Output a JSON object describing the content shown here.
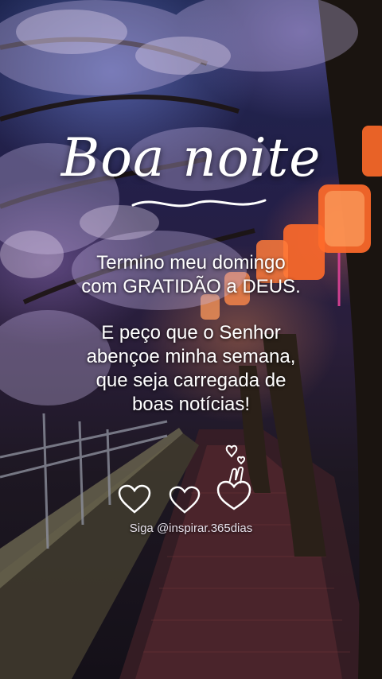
{
  "image": {
    "description_colors": {
      "sky": "#1d2550",
      "lantern": "#ff6a2a",
      "text": "#ffffff"
    }
  },
  "overlay": {
    "title": "Boa noite",
    "message_1": [
      "Termino meu domingo",
      "com GRATIDÃO a DEUS."
    ],
    "message_2": [
      "E peço que o Senhor",
      "abençoe minha semana,",
      "que seja carregada de",
      "boas notícias!"
    ],
    "handle": "Siga @inspirar.365dias"
  },
  "icons": [
    "heart-outline-icon",
    "heart-outline-icon",
    "hand-heart-icon"
  ]
}
